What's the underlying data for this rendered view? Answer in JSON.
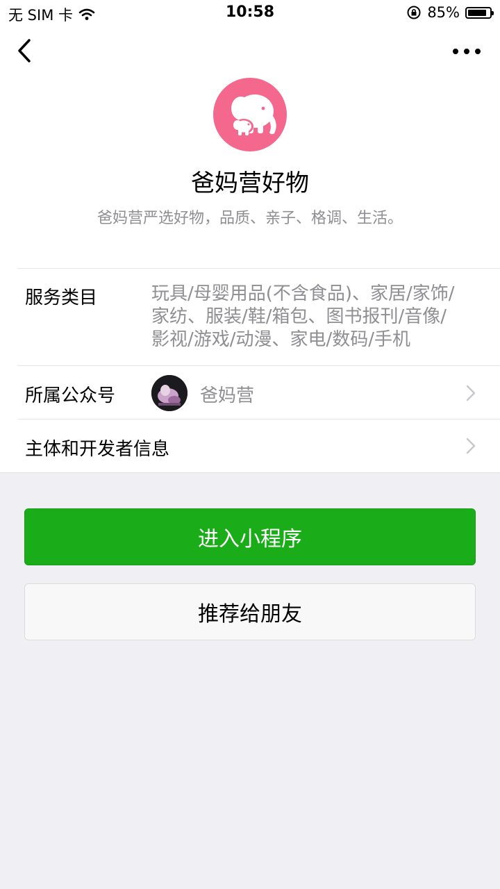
{
  "status_bar": {
    "carrier": "无 SIM 卡",
    "time": "10:58",
    "battery_percent": "85%",
    "battery_level": 0.85,
    "icons": [
      "wifi-icon",
      "orientation-lock-icon",
      "battery-icon"
    ]
  },
  "nav": {
    "back_icon": "chevron-left-icon",
    "more_icon": "more-dots-icon"
  },
  "app": {
    "logo_icon": "elephant-logo-icon",
    "logo_color": "#f4688d",
    "name": "爸妈营好物",
    "description": "爸妈营严选好物，品质、亲子、格调、生活。"
  },
  "info": {
    "service_category": {
      "label": "服务类目",
      "lines": [
        "玩具/母婴用品(不含食品)、家居/家饰/",
        "家纺、服装/鞋/箱包、图书报刊/音像/",
        "影视/游戏/动漫、家电/数码/手机"
      ]
    },
    "official_account": {
      "label": "所属公众号",
      "name": "爸妈营"
    },
    "developer_info": {
      "label": "主体和开发者信息"
    }
  },
  "actions": {
    "enter_label": "进入小程序",
    "enter_color": "#1aad19",
    "recommend_label": "推荐给朋友"
  }
}
